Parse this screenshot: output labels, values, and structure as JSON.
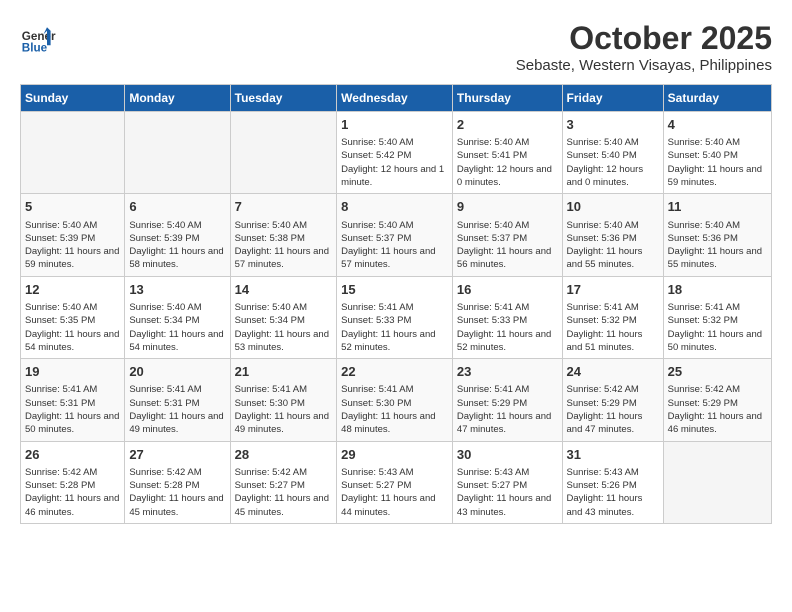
{
  "header": {
    "logo_line1": "General",
    "logo_line2": "Blue",
    "month": "October 2025",
    "location": "Sebaste, Western Visayas, Philippines"
  },
  "weekdays": [
    "Sunday",
    "Monday",
    "Tuesday",
    "Wednesday",
    "Thursday",
    "Friday",
    "Saturday"
  ],
  "weeks": [
    [
      {
        "day": "",
        "sunrise": "",
        "sunset": "",
        "daylight": "",
        "empty": true
      },
      {
        "day": "",
        "sunrise": "",
        "sunset": "",
        "daylight": "",
        "empty": true
      },
      {
        "day": "",
        "sunrise": "",
        "sunset": "",
        "daylight": "",
        "empty": true
      },
      {
        "day": "1",
        "sunrise": "Sunrise: 5:40 AM",
        "sunset": "Sunset: 5:42 PM",
        "daylight": "Daylight: 12 hours and 1 minute."
      },
      {
        "day": "2",
        "sunrise": "Sunrise: 5:40 AM",
        "sunset": "Sunset: 5:41 PM",
        "daylight": "Daylight: 12 hours and 0 minutes."
      },
      {
        "day": "3",
        "sunrise": "Sunrise: 5:40 AM",
        "sunset": "Sunset: 5:40 PM",
        "daylight": "Daylight: 12 hours and 0 minutes."
      },
      {
        "day": "4",
        "sunrise": "Sunrise: 5:40 AM",
        "sunset": "Sunset: 5:40 PM",
        "daylight": "Daylight: 11 hours and 59 minutes."
      }
    ],
    [
      {
        "day": "5",
        "sunrise": "Sunrise: 5:40 AM",
        "sunset": "Sunset: 5:39 PM",
        "daylight": "Daylight: 11 hours and 59 minutes."
      },
      {
        "day": "6",
        "sunrise": "Sunrise: 5:40 AM",
        "sunset": "Sunset: 5:39 PM",
        "daylight": "Daylight: 11 hours and 58 minutes."
      },
      {
        "day": "7",
        "sunrise": "Sunrise: 5:40 AM",
        "sunset": "Sunset: 5:38 PM",
        "daylight": "Daylight: 11 hours and 57 minutes."
      },
      {
        "day": "8",
        "sunrise": "Sunrise: 5:40 AM",
        "sunset": "Sunset: 5:37 PM",
        "daylight": "Daylight: 11 hours and 57 minutes."
      },
      {
        "day": "9",
        "sunrise": "Sunrise: 5:40 AM",
        "sunset": "Sunset: 5:37 PM",
        "daylight": "Daylight: 11 hours and 56 minutes."
      },
      {
        "day": "10",
        "sunrise": "Sunrise: 5:40 AM",
        "sunset": "Sunset: 5:36 PM",
        "daylight": "Daylight: 11 hours and 55 minutes."
      },
      {
        "day": "11",
        "sunrise": "Sunrise: 5:40 AM",
        "sunset": "Sunset: 5:36 PM",
        "daylight": "Daylight: 11 hours and 55 minutes."
      }
    ],
    [
      {
        "day": "12",
        "sunrise": "Sunrise: 5:40 AM",
        "sunset": "Sunset: 5:35 PM",
        "daylight": "Daylight: 11 hours and 54 minutes."
      },
      {
        "day": "13",
        "sunrise": "Sunrise: 5:40 AM",
        "sunset": "Sunset: 5:34 PM",
        "daylight": "Daylight: 11 hours and 54 minutes."
      },
      {
        "day": "14",
        "sunrise": "Sunrise: 5:40 AM",
        "sunset": "Sunset: 5:34 PM",
        "daylight": "Daylight: 11 hours and 53 minutes."
      },
      {
        "day": "15",
        "sunrise": "Sunrise: 5:41 AM",
        "sunset": "Sunset: 5:33 PM",
        "daylight": "Daylight: 11 hours and 52 minutes."
      },
      {
        "day": "16",
        "sunrise": "Sunrise: 5:41 AM",
        "sunset": "Sunset: 5:33 PM",
        "daylight": "Daylight: 11 hours and 52 minutes."
      },
      {
        "day": "17",
        "sunrise": "Sunrise: 5:41 AM",
        "sunset": "Sunset: 5:32 PM",
        "daylight": "Daylight: 11 hours and 51 minutes."
      },
      {
        "day": "18",
        "sunrise": "Sunrise: 5:41 AM",
        "sunset": "Sunset: 5:32 PM",
        "daylight": "Daylight: 11 hours and 50 minutes."
      }
    ],
    [
      {
        "day": "19",
        "sunrise": "Sunrise: 5:41 AM",
        "sunset": "Sunset: 5:31 PM",
        "daylight": "Daylight: 11 hours and 50 minutes."
      },
      {
        "day": "20",
        "sunrise": "Sunrise: 5:41 AM",
        "sunset": "Sunset: 5:31 PM",
        "daylight": "Daylight: 11 hours and 49 minutes."
      },
      {
        "day": "21",
        "sunrise": "Sunrise: 5:41 AM",
        "sunset": "Sunset: 5:30 PM",
        "daylight": "Daylight: 11 hours and 49 minutes."
      },
      {
        "day": "22",
        "sunrise": "Sunrise: 5:41 AM",
        "sunset": "Sunset: 5:30 PM",
        "daylight": "Daylight: 11 hours and 48 minutes."
      },
      {
        "day": "23",
        "sunrise": "Sunrise: 5:41 AM",
        "sunset": "Sunset: 5:29 PM",
        "daylight": "Daylight: 11 hours and 47 minutes."
      },
      {
        "day": "24",
        "sunrise": "Sunrise: 5:42 AM",
        "sunset": "Sunset: 5:29 PM",
        "daylight": "Daylight: 11 hours and 47 minutes."
      },
      {
        "day": "25",
        "sunrise": "Sunrise: 5:42 AM",
        "sunset": "Sunset: 5:29 PM",
        "daylight": "Daylight: 11 hours and 46 minutes."
      }
    ],
    [
      {
        "day": "26",
        "sunrise": "Sunrise: 5:42 AM",
        "sunset": "Sunset: 5:28 PM",
        "daylight": "Daylight: 11 hours and 46 minutes."
      },
      {
        "day": "27",
        "sunrise": "Sunrise: 5:42 AM",
        "sunset": "Sunset: 5:28 PM",
        "daylight": "Daylight: 11 hours and 45 minutes."
      },
      {
        "day": "28",
        "sunrise": "Sunrise: 5:42 AM",
        "sunset": "Sunset: 5:27 PM",
        "daylight": "Daylight: 11 hours and 45 minutes."
      },
      {
        "day": "29",
        "sunrise": "Sunrise: 5:43 AM",
        "sunset": "Sunset: 5:27 PM",
        "daylight": "Daylight: 11 hours and 44 minutes."
      },
      {
        "day": "30",
        "sunrise": "Sunrise: 5:43 AM",
        "sunset": "Sunset: 5:27 PM",
        "daylight": "Daylight: 11 hours and 43 minutes."
      },
      {
        "day": "31",
        "sunrise": "Sunrise: 5:43 AM",
        "sunset": "Sunset: 5:26 PM",
        "daylight": "Daylight: 11 hours and 43 minutes."
      },
      {
        "day": "",
        "sunrise": "",
        "sunset": "",
        "daylight": "",
        "empty": true
      }
    ]
  ]
}
